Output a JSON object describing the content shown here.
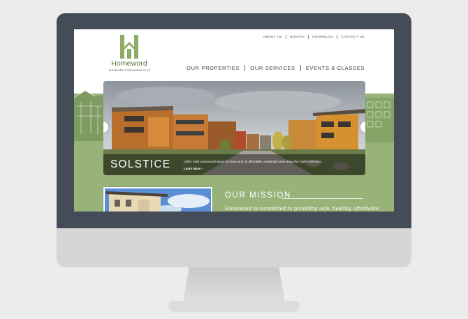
{
  "site": {
    "logo_name": "Homeword",
    "logo_tagline": "Sustainable Communities for All"
  },
  "utility_nav": [
    "ABOUT US",
    "DONATE",
    "HOMEBLOG",
    "CONTACT US"
  ],
  "main_nav": [
    "OUR PROPERTIES",
    "OUR SERVICES",
    "EVENTS & CLASSES"
  ],
  "slider": {
    "title": "SOLSTICE",
    "description": "LEED Gold commercial space for lease and 34 affordable, residential units along the Clark Fork River.",
    "link": "Learn More ›",
    "prev_icon": "chevron-left-icon",
    "next_icon": "chevron-right-icon"
  },
  "mission": {
    "title": "OUR MISSION",
    "text": "Homeword is committed to providing safe, healthy, affordable"
  },
  "colors": {
    "brand_green": "#98b37a",
    "logo_green": "#8eab66",
    "monitor_bezel": "#444c58"
  }
}
